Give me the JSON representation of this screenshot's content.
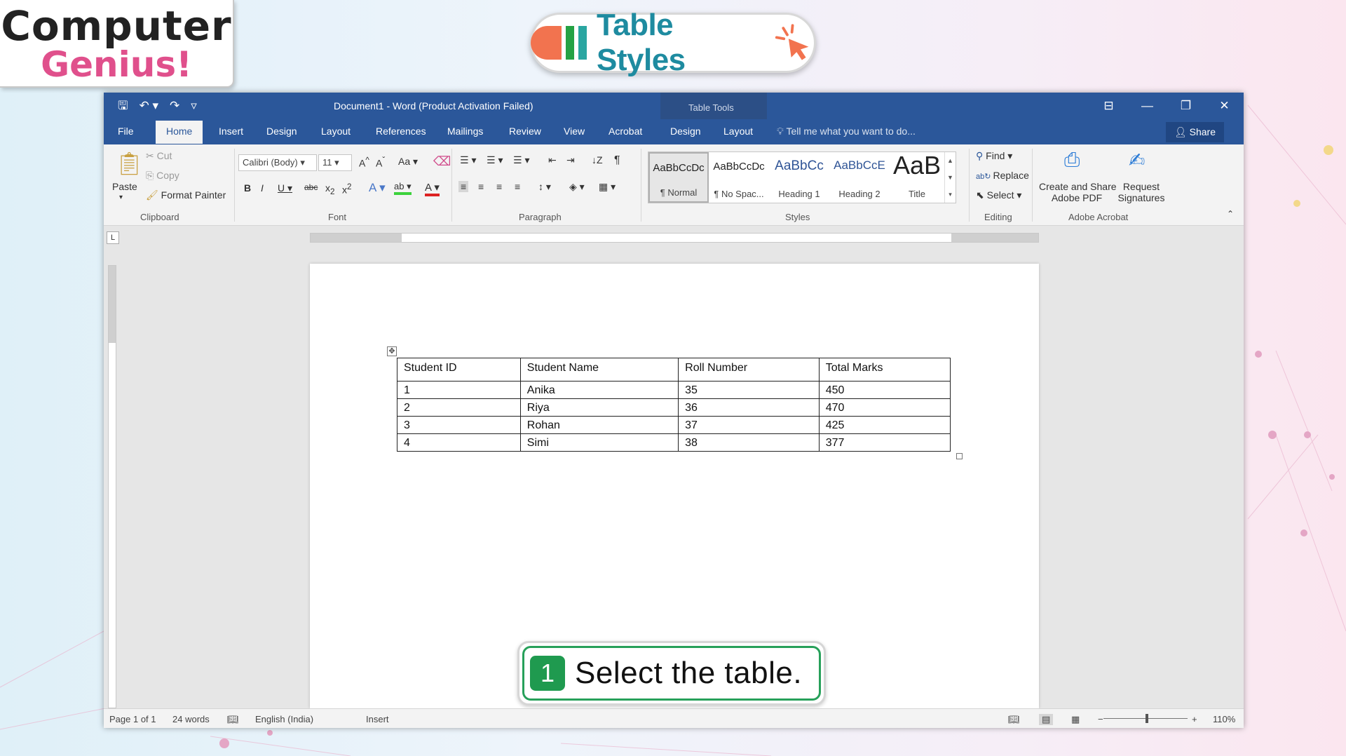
{
  "logo": {
    "line1": "Computer",
    "line2": "Genius!"
  },
  "banner": {
    "title": "Table Styles"
  },
  "window": {
    "doc_title": "Document1 - Word (Product Activation Failed)",
    "context_label": "Table Tools",
    "qat": {
      "save": "🖫",
      "undo": "↶ ▾",
      "redo": "↷",
      "customize": "▿"
    },
    "controls": {
      "ribbon_options": "⊟",
      "minimize": "—",
      "restore": "❐",
      "close": "✕"
    }
  },
  "tabs": {
    "file": "File",
    "home": "Home",
    "insert": "Insert",
    "design": "Design",
    "layout": "Layout",
    "references": "References",
    "mailings": "Mailings",
    "review": "Review",
    "view": "View",
    "acrobat": "Acrobat",
    "table_design": "Design",
    "table_layout": "Layout",
    "tell_me": "Tell me what you want to do...",
    "share": "Share"
  },
  "ribbon": {
    "clipboard": {
      "paste": "Paste",
      "cut": "Cut",
      "copy": "Copy",
      "format_painter": "Format Painter",
      "label": "Clipboard"
    },
    "font": {
      "name": "Calibri (Body)",
      "size": "11",
      "label": "Font"
    },
    "paragraph": {
      "label": "Paragraph"
    },
    "styles": {
      "label": "Styles",
      "items": [
        {
          "preview": "AaBbCcDc",
          "name": "¶ Normal"
        },
        {
          "preview": "AaBbCcDc",
          "name": "¶ No Spac..."
        },
        {
          "preview": "AaBbCc",
          "name": "Heading 1"
        },
        {
          "preview": "AaBbCcE",
          "name": "Heading 2"
        },
        {
          "preview": "AaB",
          "name": "Title"
        }
      ]
    },
    "editing": {
      "find": "Find",
      "replace": "Replace",
      "select": "Select",
      "label": "Editing"
    },
    "acrobat": {
      "create_line1": "Create and Share",
      "create_line2": "Adobe PDF",
      "request_line1": "Request",
      "request_line2": "Signatures",
      "label": "Adobe Acrobat"
    }
  },
  "table": {
    "headers": [
      "Student ID",
      "Student Name",
      "Roll Number",
      "Total Marks"
    ],
    "rows": [
      [
        "1",
        "Anika",
        "35",
        "450"
      ],
      [
        "2",
        "Riya",
        "36",
        "470"
      ],
      [
        "3",
        "Rohan",
        "37",
        "425"
      ],
      [
        "4",
        "Simi",
        "38",
        "377"
      ]
    ]
  },
  "callout": {
    "step": "1",
    "text": "Select the table."
  },
  "status": {
    "page": "Page 1 of 1",
    "words": "24 words",
    "language": "English (India)",
    "mode": "Insert",
    "zoom": "110%",
    "zoom_minus": "−",
    "zoom_plus": "+"
  },
  "colors": {
    "word_blue": "#2b579a",
    "title_teal": "#1e8ba0",
    "callout_green": "#27a05a",
    "logo_pink": "#e0508c"
  }
}
